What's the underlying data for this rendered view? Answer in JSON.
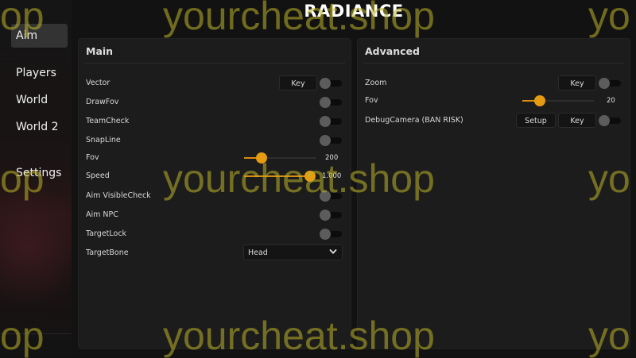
{
  "title": "RADIANCE",
  "sidebar": {
    "items": [
      {
        "label": "Aim",
        "active": true
      },
      {
        "label": "Players"
      },
      {
        "label": "World"
      },
      {
        "label": "World 2"
      },
      {
        "label": "Settings"
      }
    ]
  },
  "main_panel": {
    "title": "Main",
    "vector_label": "Vector",
    "vector_key": "Key",
    "drawfov_label": "DrawFov",
    "teamcheck_label": "TeamCheck",
    "snapline_label": "SnapLine",
    "fov_label": "Fov",
    "fov_value": "200",
    "fov_fraction": 0.2,
    "speed_label": "Speed",
    "speed_value": "1.000",
    "speed_fraction": 1.0,
    "aimvisible_label": "Aim VisibleCheck",
    "aimnpc_label": "Aim NPC",
    "targetlock_label": "TargetLock",
    "targetbone_label": "TargetBone",
    "targetbone_value": "Head"
  },
  "advanced_panel": {
    "title": "Advanced",
    "zoom_label": "Zoom",
    "zoom_key": "Key",
    "fov_label": "Fov",
    "fov_value": "20",
    "fov_fraction": 0.2,
    "debugcamera_label": "DebugCamera (BAN RISK)",
    "debugcamera_setup": "Setup",
    "debugcamera_key": "Key"
  },
  "watermark": {
    "text_full": "yourcheat.shop",
    "text_left": "op",
    "text_right": "yo"
  },
  "colors": {
    "accent": "#e59b12",
    "panel_bg": "#1c1c1c",
    "toggle_off": "#5c5c5c"
  }
}
